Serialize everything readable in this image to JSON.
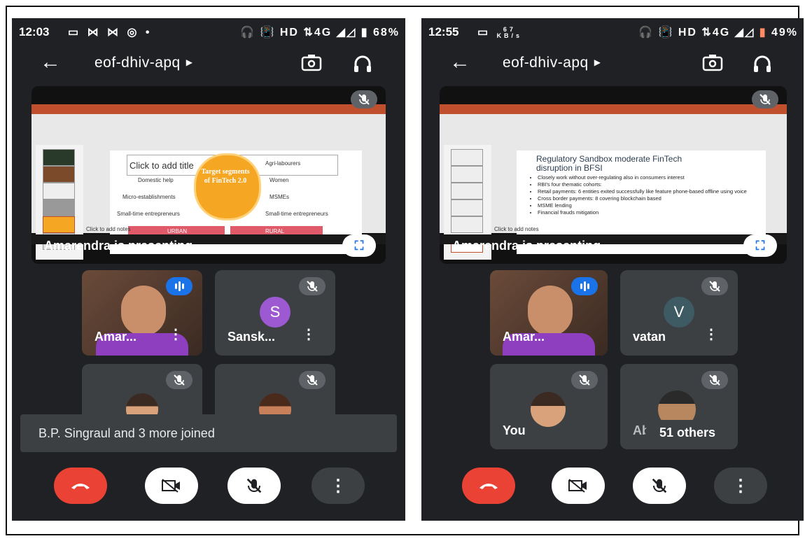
{
  "left": {
    "status": {
      "time": "12:03",
      "notif_icons": "▭ ⋈ ⋈ ◎ •",
      "network": "HD ⇅4G",
      "battery": "68%"
    },
    "meeting_code": "eof-dhiv-apq",
    "slide": {
      "title": "Click to add title",
      "center": "Target segments of FinTech 2.0",
      "left_items": [
        "Domestic help",
        "Micro-establishments",
        "Small-time entrepreneurs"
      ],
      "right_items": [
        "Agri-labourers",
        "Women",
        "MSMEs",
        "Small-time entrepreneurs"
      ],
      "urban": "URBAN",
      "rural": "RURAL",
      "notes": "Click to add notes"
    },
    "presenting": "Amarendra is presenting",
    "tiles": [
      {
        "name": "Amar...",
        "kind": "video"
      },
      {
        "name": "Sansk...",
        "kind": "letter",
        "letter": "S",
        "color": "#9c59d1"
      },
      {
        "name": "",
        "kind": "face"
      },
      {
        "name": "",
        "kind": "face"
      }
    ],
    "toast": "B.P. Singraul and 3 more joined"
  },
  "right": {
    "status": {
      "time": "12:55",
      "speed": "67",
      "speed_unit": "KB/s",
      "network": "HD ⇅4G",
      "battery": "49%"
    },
    "meeting_code": "eof-dhiv-apq",
    "slide": {
      "title": "Regulatory Sandbox moderate FinTech disruption in BFSI",
      "bullets": [
        "Closely work without over-regulating also in consumers interest",
        "RBI's four thematic cohorts:",
        "Retail payments: 6 entities exited successfully like feature phone-based offline using voice",
        "Cross border payments: 8 covering blockchain based",
        "MSME lending",
        "Financial frauds mitigation"
      ],
      "notes": "Click to add notes"
    },
    "presenting": "Amarendra is presenting",
    "tiles": [
      {
        "name": "Amar...",
        "kind": "video"
      },
      {
        "name": "vatan",
        "kind": "letter",
        "letter": "V",
        "color": "#3e5a63"
      },
      {
        "name": "You",
        "kind": "face"
      },
      {
        "name": "Abh...Kum...",
        "kind": "face"
      }
    ],
    "others": "51 others"
  },
  "icons": {
    "back": "arrow-left",
    "flip": "camera-flip",
    "audio": "headphones",
    "end": "phone-hangup",
    "camera": "camera-off",
    "mic": "mic-off",
    "more": "more-vert",
    "fullscreen": "fullscreen"
  },
  "colors": {
    "background": "#202124",
    "tile": "#3c4043",
    "end_call": "#ea4335",
    "speaking": "#1a73e8"
  }
}
